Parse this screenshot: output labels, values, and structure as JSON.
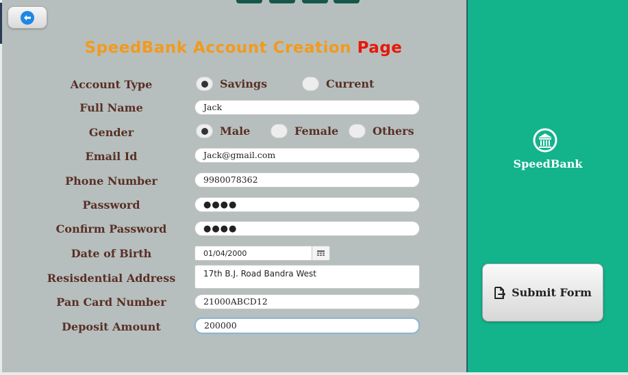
{
  "header": {
    "title_part1": "SpeedBank Account Creation ",
    "title_part2": "Page"
  },
  "form": {
    "account_type": {
      "label": "Account Type",
      "options": [
        "Savings",
        "Current"
      ],
      "selected": "Savings"
    },
    "full_name": {
      "label": "Full Name",
      "value": "Jack"
    },
    "gender": {
      "label": "Gender",
      "options": [
        "Male",
        "Female",
        "Others"
      ],
      "selected": "Male"
    },
    "email": {
      "label": "Email Id",
      "value": "Jack@gmail.com"
    },
    "phone": {
      "label": "Phone Number",
      "value": "9980078362"
    },
    "password": {
      "label": "Password",
      "value": "●●●●"
    },
    "confirm_password": {
      "label": "Confirm Password",
      "value": "●●●●"
    },
    "dob": {
      "label": "Date of Birth",
      "value": "01/04/2000"
    },
    "address": {
      "label": "Resisdential Address",
      "value": "17th B.J. Road Bandra West"
    },
    "pan": {
      "label": "Pan Card Number",
      "value": "21000ABCD12"
    },
    "deposit": {
      "label": "Deposit Amount",
      "value": "200000"
    }
  },
  "sidebar": {
    "brand_name": "SpeedBank",
    "brand_icon": "bank-icon",
    "submit_label": "Submit Form",
    "submit_icon": "file-export-icon"
  },
  "colors": {
    "title_orange": "#f29a1e",
    "title_red": "#e8170b",
    "label_brown": "#5a2f27",
    "panel_gray": "#b6bfbd",
    "sidebar_green": "#13b38c",
    "back_blue": "#1e88e5"
  }
}
